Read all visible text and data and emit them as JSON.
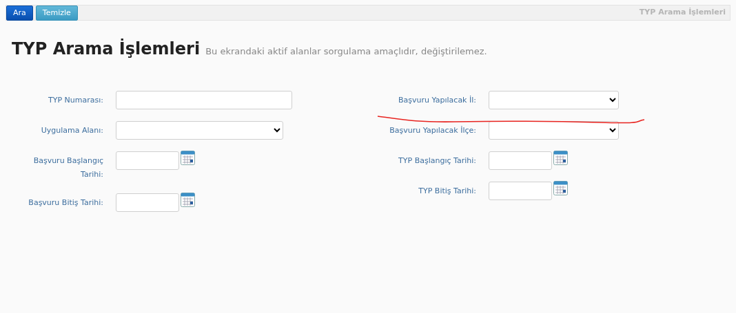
{
  "toolbar": {
    "buttons": [
      {
        "label": "Ara",
        "kind": "primary"
      },
      {
        "label": "Temizle",
        "kind": "info"
      }
    ],
    "breadcrumb": "TYP Arama İşlemleri"
  },
  "header": {
    "title": "TYP Arama İşlemleri",
    "subtitle": "Bu ekrandaki aktif alanlar sorgulama amaçlıdır, değiştirilemez."
  },
  "form": {
    "left_fields": [
      {
        "label": "TYP Numarası:",
        "kind": "text"
      },
      {
        "label": "Uygulama Alanı:",
        "kind": "select"
      },
      {
        "label": "Başvuru Başlangıç Tarihi:",
        "kind": "date"
      },
      {
        "label": "Başvuru Bitiş Tarihi:",
        "kind": "date"
      }
    ],
    "right_fields": [
      {
        "label": "Başvuru Yapılacak İl:",
        "kind": "select"
      },
      {
        "label": "Başvuru Yapılacak İlçe:",
        "kind": "select"
      },
      {
        "label": "TYP Başlangıç Tarihi:",
        "kind": "date"
      },
      {
        "label": "TYP Bitiş Tarihi:",
        "kind": "date"
      }
    ]
  },
  "annotations": [
    {
      "kind": "freehand-line",
      "color": "#e8231f"
    }
  ]
}
